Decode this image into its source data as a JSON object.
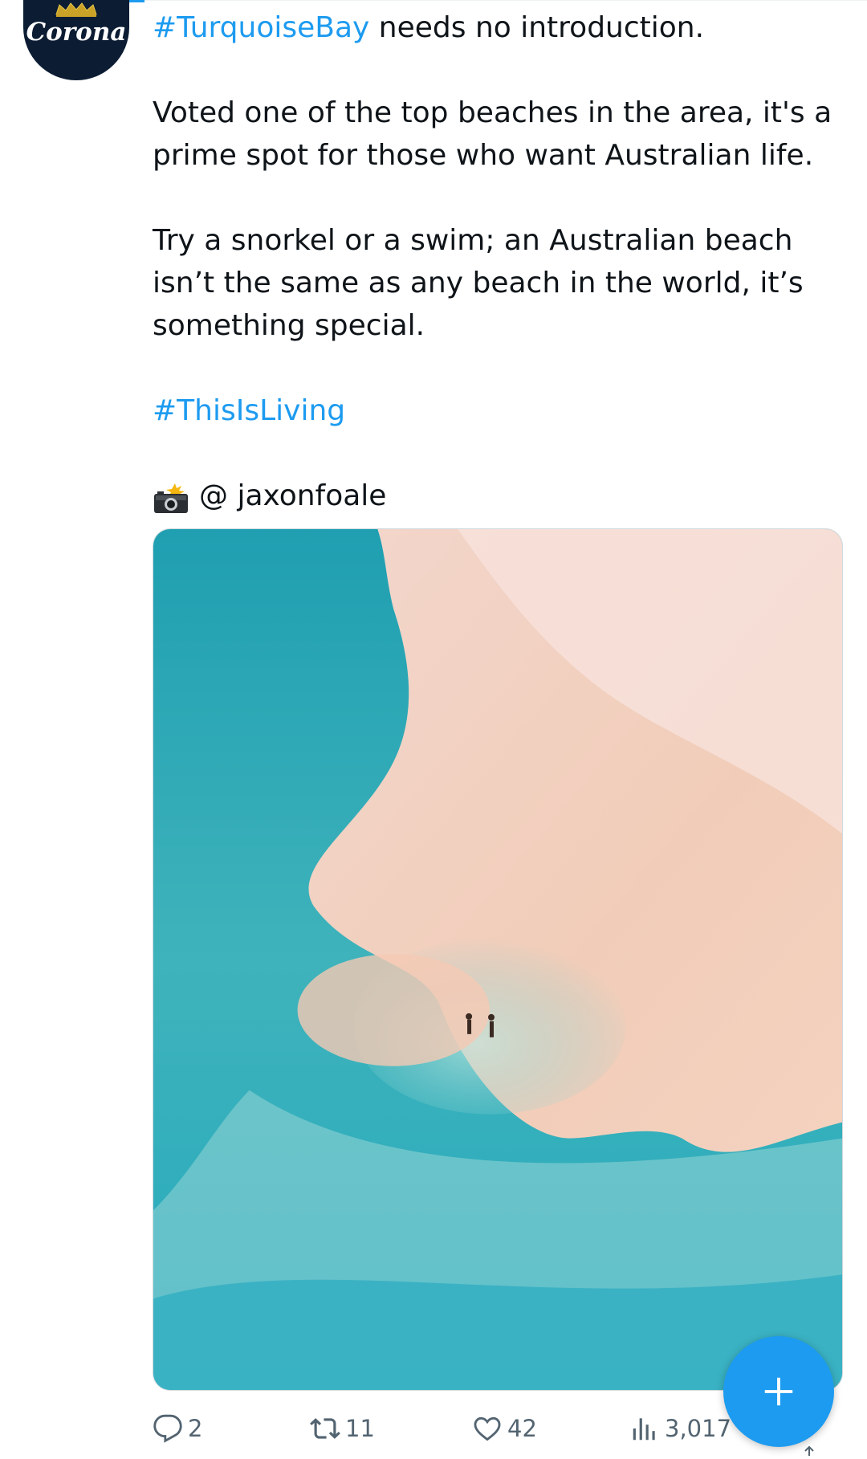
{
  "tweet": {
    "author_logo_text": "Corona",
    "line1": {
      "hashtag": "#TurquoiseBay",
      "rest": " needs no introduction."
    },
    "paragraph2": "Voted one of the top beaches in the area, it's a prime spot for those who want Australian life.",
    "paragraph3": "Try a snorkel or a swim; an Australian beach isn’t the same as any beach in the world, it’s something special.",
    "hashtag2": "#ThisIsLiving",
    "photo_credit": "@ jaxonfoale"
  },
  "actions": {
    "replies": "2",
    "retweets": "11",
    "likes": "42",
    "views": "3,017"
  },
  "colors": {
    "link": "#1d9bf0",
    "text": "#0f1419",
    "muted": "#536471",
    "fab": "#1d9bf0"
  },
  "icons": {
    "reply": "reply-icon",
    "retweet": "retweet-icon",
    "like": "heart-icon",
    "views": "views-icon",
    "compose": "plus-icon",
    "camera": "camera-flash-icon"
  }
}
